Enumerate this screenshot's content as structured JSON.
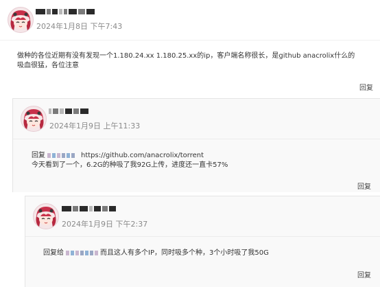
{
  "comments": [
    {
      "username": "",
      "time": "2024年1月8日 下午7:43",
      "lines": [
        "做种的各位近期有没有发现一个1.180.24.xx 1.180.25.xx的ip，客户端名称很长，是github anacrolix什么的",
        "吸血很猛，各位注意"
      ],
      "reply_label": "回复"
    },
    {
      "username": "",
      "time": "2024年1月9日 上午11:33",
      "reply_prefix": "回复",
      "mention": "",
      "link": "https://github.com/anacrolix/torrent",
      "line2": "今天看到了一个，6.2G的种吸了我92G上传，进度还一直卡57%",
      "reply_label": "回复"
    },
    {
      "username": "",
      "time": "2024年1月9日 下午2:37",
      "reply_prefix": "回复给",
      "mention": "",
      "text": "而且这人有多个IP，同时吸多个种，3个小时吸了我50G",
      "reply_label": "回复"
    }
  ],
  "colors": {
    "text": "#333333",
    "meta": "#8a8a8a",
    "nested_bg": "#f9f9f9",
    "border": "#e4e4e4"
  },
  "icons": {
    "avatar": "anime-girl-avatar-icon"
  }
}
